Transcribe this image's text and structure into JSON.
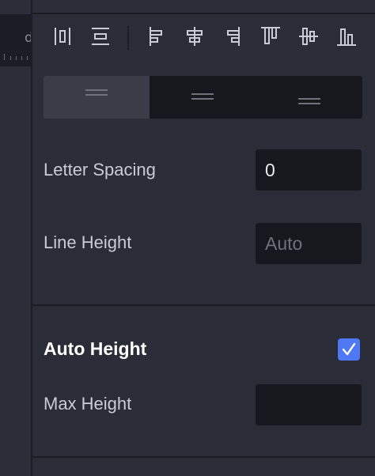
{
  "ruler": {
    "partial_label": "d"
  },
  "alignment_toolbar": {
    "buttons": [
      {
        "name": "distribute-horizontal-icon"
      },
      {
        "name": "distribute-vertical-icon"
      },
      {
        "name": "align-left-icon"
      },
      {
        "name": "align-center-horizontal-icon"
      },
      {
        "name": "align-right-icon"
      },
      {
        "name": "align-top-icon"
      },
      {
        "name": "align-center-vertical-icon"
      },
      {
        "name": "align-bottom-icon"
      }
    ]
  },
  "vertical_text_align": {
    "options": [
      "top-align-icon",
      "middle-align-icon",
      "bottom-align-icon"
    ],
    "selected": "top-align-icon"
  },
  "typography": {
    "letter_spacing": {
      "label": "Letter Spacing",
      "value": "0"
    },
    "line_height": {
      "label": "Line Height",
      "value": "",
      "placeholder": "Auto"
    }
  },
  "auto_height": {
    "title": "Auto Height",
    "checked": true,
    "max_height": {
      "label": "Max Height",
      "value": ""
    }
  },
  "colors": {
    "panel_bg": "#2a2c37",
    "input_bg": "#16181e",
    "checkbox_accent": "#4f78f5",
    "icon_color": "#c9ccd6"
  }
}
